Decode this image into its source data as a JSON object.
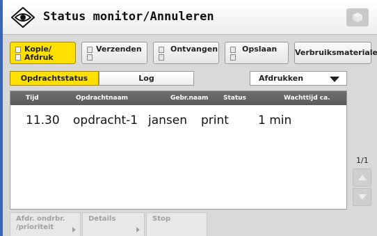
{
  "window": {
    "title": "Status monitor/Annuleren",
    "title_icon": "eye-status-icon",
    "corner_icon": "cube-icon"
  },
  "function_tabs": [
    {
      "line1": "Kopie/",
      "line2": "Afdruk",
      "active": true
    },
    {
      "line1": "Verzenden",
      "line2": "",
      "active": false
    },
    {
      "line1": "Ontvangen",
      "line2": "",
      "active": false
    },
    {
      "line1": "Opslaan",
      "line2": "",
      "active": false
    },
    {
      "line1": "Verbruiksmaterialen",
      "line2": "",
      "active": false
    }
  ],
  "sub_tabs": [
    {
      "label": "Opdrachtstatus",
      "active": true
    },
    {
      "label": "Log",
      "active": false
    }
  ],
  "filter": {
    "selected": "Afdrukken"
  },
  "table": {
    "columns": [
      "Tijd",
      "Opdrachtnaam",
      "Gebr.naam",
      "Status",
      "Wachttijd ca."
    ],
    "rows": [
      [
        "11.30",
        "opdracht-1",
        "jansen",
        "print",
        "1 min"
      ]
    ]
  },
  "pager": {
    "page": "1/1"
  },
  "actions": [
    {
      "line1": "Afdr. ondrbr.",
      "line2": "/prioriteit",
      "enabled": false
    },
    {
      "line1": "Details",
      "line2": "",
      "enabled": false
    },
    {
      "line1": "Stop",
      "line2": "",
      "enabled": false
    }
  ],
  "colors": {
    "accent_active": "#ffe000",
    "header_bg": "#5f5f5f",
    "screen_bg": "#d9d9d9",
    "left_border": "#3a66b7"
  }
}
